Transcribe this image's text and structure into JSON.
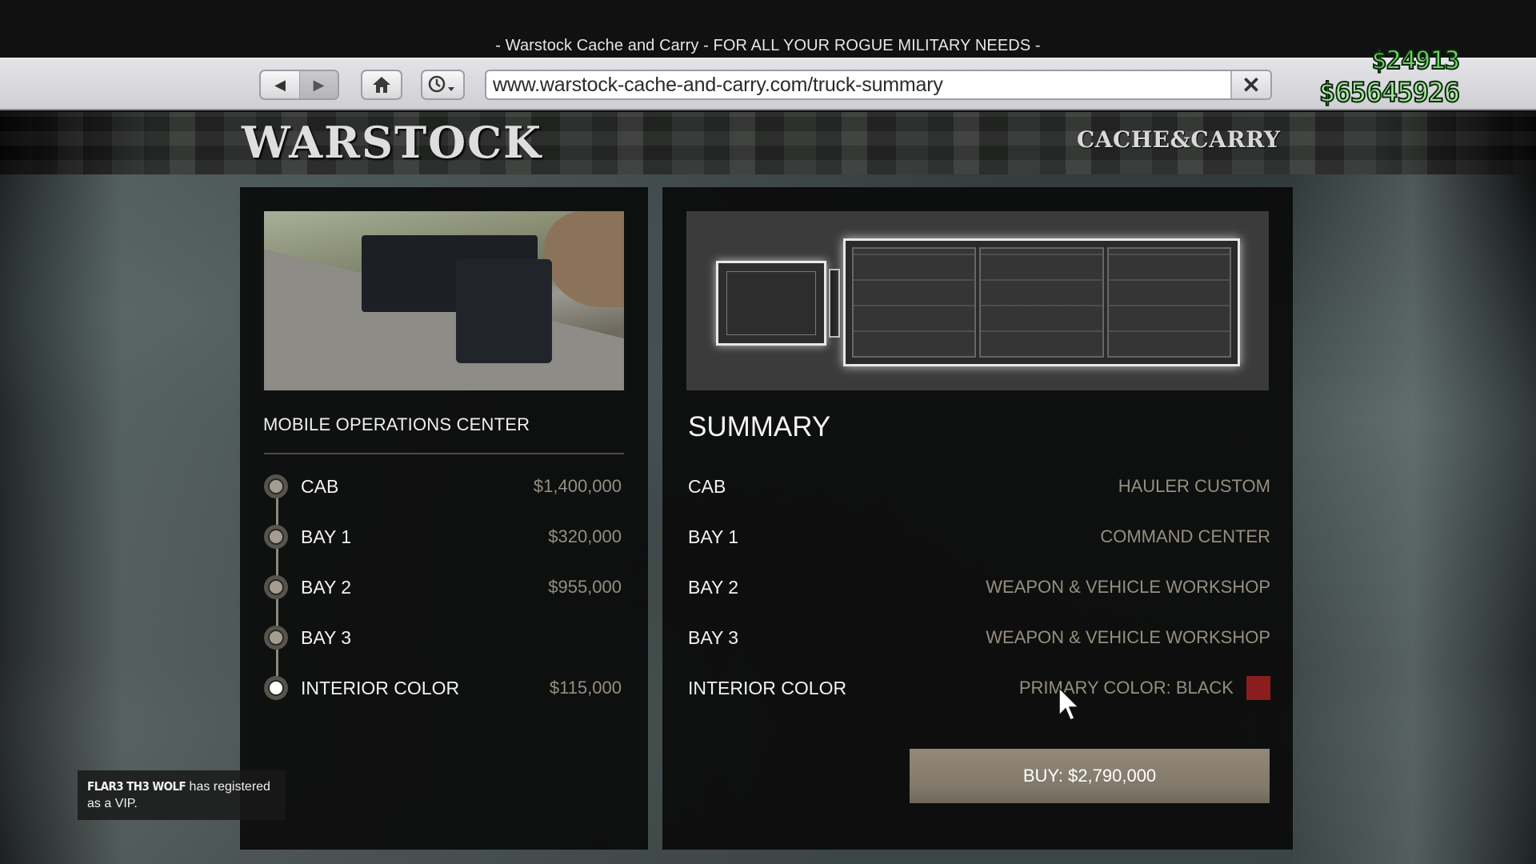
{
  "window": {
    "title": "- Warstock Cache and Carry - FOR ALL YOUR ROGUE MILITARY NEEDS -"
  },
  "browser": {
    "back_icon": "back-arrow-icon",
    "forward_icon": "forward-arrow-icon",
    "home_icon": "home-icon",
    "history_icon": "clock-dropdown-icon",
    "url": "www.warstock-cache-and-carry.com/truck-summary",
    "close_icon": "close-x-icon",
    "back_glyph": "◀",
    "forward_glyph": "▶",
    "close_glyph": "✕"
  },
  "hud": {
    "wallet_cash": "$24913",
    "bank_cash": "$65645926",
    "wallet_color": "#72d26a",
    "bank_color": "#a8e6a0"
  },
  "site": {
    "logo": "WARSTOCK",
    "tagline": "CACHE&CARRY"
  },
  "left_panel": {
    "image_alt": "Mobile Operations Center truck photo",
    "title": "MOBILE OPERATIONS CENTER",
    "steps": [
      {
        "label": "CAB",
        "price": "$1,400,000",
        "active": false
      },
      {
        "label": "BAY 1",
        "price": "$320,000",
        "active": false
      },
      {
        "label": "BAY 2",
        "price": "$955,000",
        "active": false
      },
      {
        "label": "BAY 3",
        "price": "",
        "active": false
      },
      {
        "label": "INTERIOR COLOR",
        "price": "$115,000",
        "active": true
      }
    ]
  },
  "right_panel": {
    "image_alt": "Truck blueprint top view",
    "title": "SUMMARY",
    "rows": [
      {
        "key": "CAB",
        "value": "HAULER CUSTOM"
      },
      {
        "key": "BAY 1",
        "value": "COMMAND CENTER"
      },
      {
        "key": "BAY 2",
        "value": "WEAPON & VEHICLE WORKSHOP"
      },
      {
        "key": "BAY 3",
        "value": "WEAPON & VEHICLE WORKSHOP"
      },
      {
        "key": "INTERIOR COLOR",
        "value": "PRIMARY COLOR: BLACK"
      }
    ],
    "swatch_color": "#8a1e1e",
    "buy_label": "BUY: $2,790,000"
  },
  "notification": {
    "player": "FLAR3 TH3 WOLF",
    "message": " has registered as a VIP."
  },
  "colors": {
    "accent_button": "#8a806f",
    "value_text": "#968f80"
  }
}
